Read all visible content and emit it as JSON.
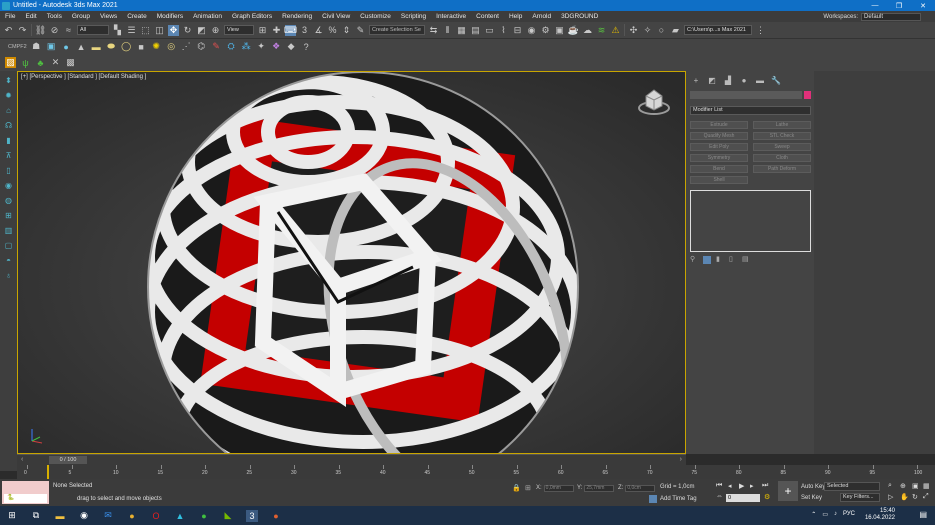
{
  "window": {
    "title": "Untitled - Autodesk 3ds Max 2021",
    "controls": [
      "—",
      "❐",
      "✕"
    ]
  },
  "menu": {
    "items": [
      "File",
      "Edit",
      "Tools",
      "Group",
      "Views",
      "Create",
      "Modifiers",
      "Animation",
      "Graph Editors",
      "Rendering",
      "Civil View",
      "Customize",
      "Scripting",
      "Interactive",
      "Content",
      "Help",
      "Arnold",
      "3DGROUND"
    ],
    "workspace_label": "Workspaces:",
    "workspace_value": "Default"
  },
  "toolbar": {
    "filter_value": "All",
    "coord_system": "View",
    "selection_set_placeholder": "Create Selection Se",
    "project_path": "C:\\Users\\p...s Max 2021"
  },
  "toolbar2": {
    "label": "CMPF2"
  },
  "viewport": {
    "label": "[+] [Perspective ] [Standard ] [Default Shading ]"
  },
  "command_panel": {
    "modifier_list": "Modifier List",
    "buttons": [
      "Extrude",
      "Lathe",
      "Quadify Mesh",
      "STL Check",
      "Edit Poly",
      "Sweep",
      "Symmetry",
      "Cloth",
      "Bend",
      "Path Deform",
      "Shell"
    ],
    "accent_color": "#e0307a"
  },
  "timeline": {
    "frame_display": "0 / 100",
    "ticks": [
      0,
      5,
      10,
      15,
      20,
      25,
      30,
      35,
      40,
      45,
      50,
      55,
      60,
      65,
      70,
      75,
      80,
      85,
      90,
      95,
      100
    ]
  },
  "status": {
    "maxscript_label": "🐍",
    "selection": "None Selected",
    "prompt": "drag to select and move objects",
    "x_label": "X:",
    "x_value": "0,0mm",
    "y_label": "Y:",
    "y_value": "25,7mm",
    "z_label": "Z:",
    "z_value": "0,0cm",
    "grid": "Grid = 1,0cm",
    "add_time_tag": "Add Time Tag",
    "auto_key": "Auto Key",
    "set_key": "Set Key",
    "key_mode": "Selected",
    "key_filters": "Key Filters...",
    "frame_field": "0"
  },
  "taskbar": {
    "icons": [
      "windows-icon",
      "search-icon",
      "file-explorer-icon",
      "obs-icon",
      "mail-icon",
      "chrome-icon",
      "opera-icon",
      "photos-icon",
      "xbox-icon",
      "nvidia-icon",
      "3dsmax-icon",
      "app-icon"
    ],
    "language": "РУС",
    "time": "15:40",
    "date": "16.04.2022"
  }
}
